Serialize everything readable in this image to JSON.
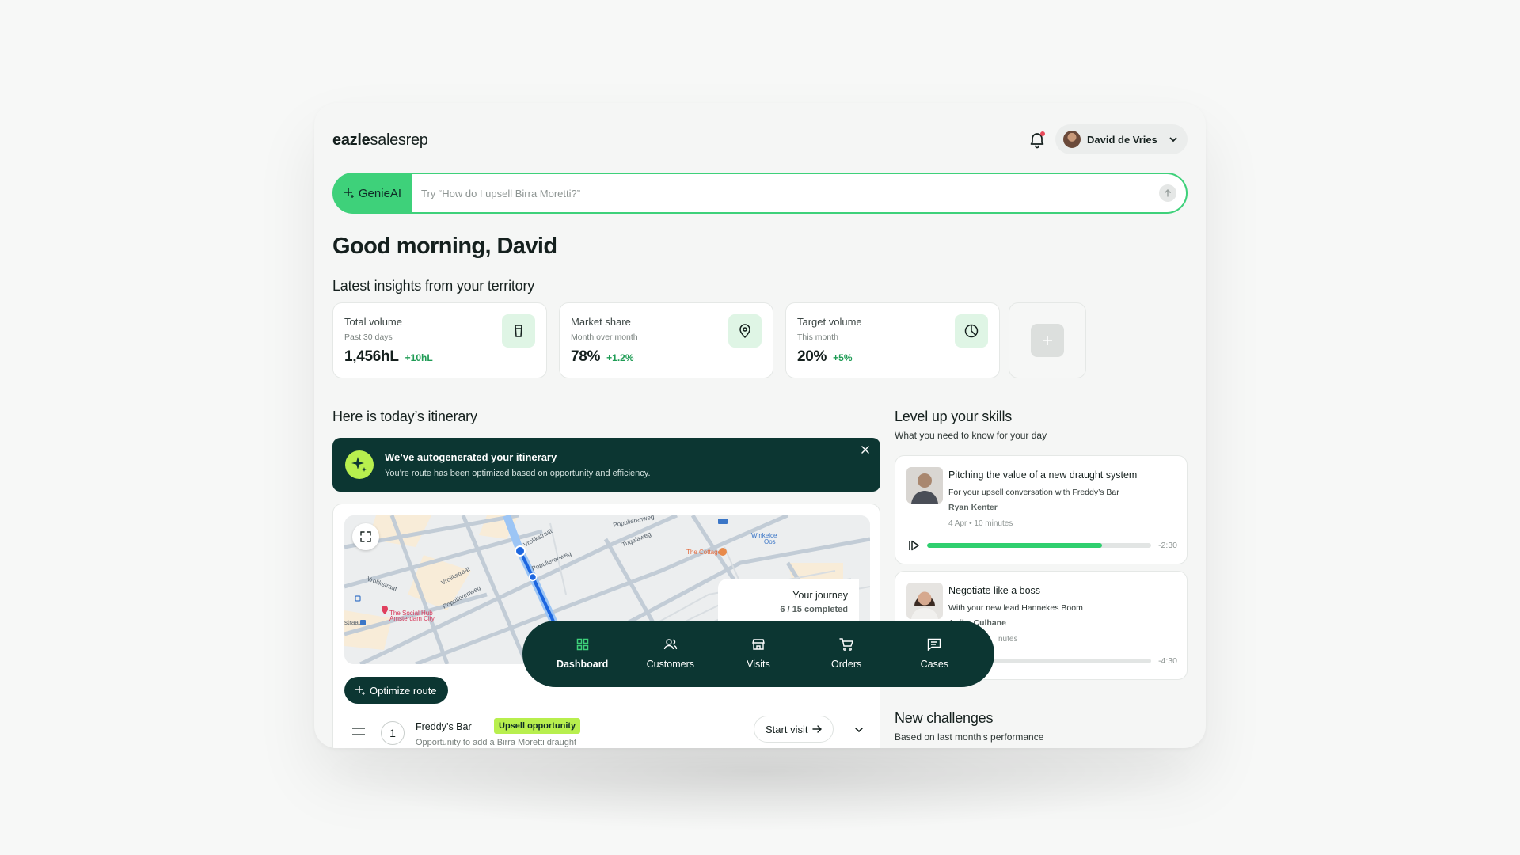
{
  "header": {
    "logo_bold": "eazle",
    "logo_light": "salesrep",
    "user_name": "David de Vries"
  },
  "search": {
    "genie_label": "GenieAI",
    "placeholder": "Try “How do I upsell Birra Moretti?”"
  },
  "greeting": "Good morning, David",
  "insights": {
    "title": "Latest insights from your territory",
    "cards": [
      {
        "title": "Total volume",
        "sub": "Past 30 days",
        "value": "1,456hL",
        "delta": "+10hL",
        "icon": "glass-icon"
      },
      {
        "title": "Market share",
        "sub": "Month over month",
        "value": "78%",
        "delta": "+1.2%",
        "icon": "location-pin-icon"
      },
      {
        "title": "Target volume",
        "sub": "This month",
        "value": "20%",
        "delta": "+5%",
        "icon": "pie-chart-icon"
      }
    ]
  },
  "itinerary": {
    "title": "Here is today’s itinerary",
    "banner_title": "We’ve autogenerated your itinerary",
    "banner_sub": "You’re route has been optimized based on opportunity and efficiency.",
    "journey_title": "Your journey",
    "journey_progress": "6 / 15 completed",
    "optimize_label": "Optimize route",
    "map_labels": {
      "street1": "Vrolikstraat",
      "street2": "Populierenweg",
      "street3": "Tugelaweg",
      "street4": "Populierenweg",
      "street5": "Vrolikstraat",
      "street6": "Vrolikstraat",
      "street7": "Populierenweg",
      "poi1": "The Cottage",
      "poi2a": "The Social Hub",
      "poi2b": "Amsterdam City",
      "place1a": "Winkelce",
      "place1b": "Oos",
      "metro": "straat"
    },
    "stops": [
      {
        "number": "1",
        "name": "Freddy’s Bar",
        "tag": "Upsell opportunity",
        "desc": "Opportunity to add a Birra Moretti draught",
        "action": "Start visit"
      }
    ]
  },
  "skills": {
    "title": "Level up your skills",
    "sub": "What you need to know for your day",
    "cards": [
      {
        "title": "Pitching the value of a new draught system",
        "sub": "For your upsell conversation with Freddy’s Bar",
        "author": "Ryan Kenter",
        "meta": "4 Apr • 10 minutes",
        "progress": 0.78,
        "remaining": "-2:30"
      },
      {
        "title": "Negotiate like a boss",
        "sub": "With your new lead Hannekes Boom",
        "author": "Anika Culhane",
        "meta": "nutes",
        "progress": 0.3,
        "remaining": "-4:30"
      }
    ]
  },
  "challenges": {
    "title": "New challenges",
    "sub": "Based on last month's performance"
  },
  "nav": {
    "items": [
      {
        "label": "Dashboard",
        "icon": "dashboard-icon",
        "active": true
      },
      {
        "label": "Customers",
        "icon": "customers-icon"
      },
      {
        "label": "Visits",
        "icon": "store-icon"
      },
      {
        "label": "Orders",
        "icon": "cart-icon"
      },
      {
        "label": "Cases",
        "icon": "chat-icon"
      }
    ]
  },
  "colors": {
    "brand_green": "#3ed17a",
    "dark_teal": "#0c3632",
    "lime": "#b8ef4e",
    "positive": "#1f9c55"
  }
}
